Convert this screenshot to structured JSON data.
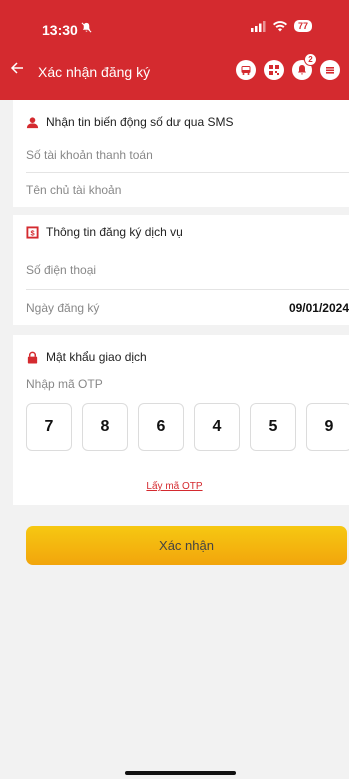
{
  "status_bar": {
    "time": "13:30",
    "battery": "77"
  },
  "nav": {
    "back_icon": "arrow-left-icon",
    "title": "Xác nhận đăng ký",
    "notification_count": "2"
  },
  "sms_section": {
    "title": "Nhận tin biến động số dư qua SMS",
    "icon": "user-icon",
    "fields": {
      "account_number_placeholder": "Số tài khoản thanh toán",
      "account_holder_placeholder": "Tên chủ tài khoản"
    }
  },
  "service_section": {
    "title": "Thông tin đăng ký dịch vụ",
    "icon": "dollar-icon",
    "phone_label": "Số điện thoại",
    "register_date_label": "Ngày đăng ký",
    "register_date_value": "09/01/2024"
  },
  "password_section": {
    "title": "Mật khẩu giao dịch",
    "icon": "lock-icon",
    "otp_label": "Nhập mã OTP",
    "otp_digits": [
      "7",
      "8",
      "6",
      "4",
      "5",
      "9"
    ],
    "get_otp_link": "Lấy mã OTP"
  },
  "confirm_button": "Xác nhận",
  "colors": {
    "brand_red": "#d42a2f",
    "button_yellow": "#f6c812"
  }
}
